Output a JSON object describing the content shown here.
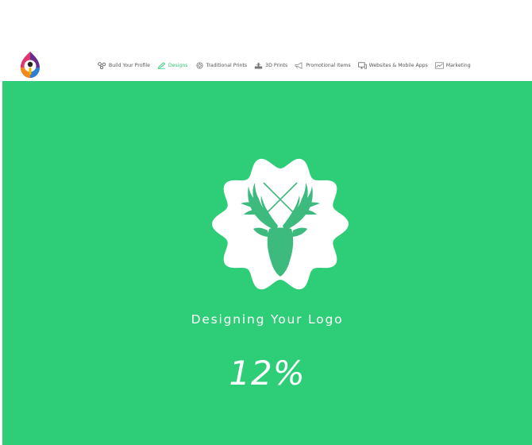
{
  "nav": {
    "items": [
      {
        "label": "Build Your Profile",
        "icon": "connection-icon",
        "active": false
      },
      {
        "label": "Designs",
        "icon": "pen-icon",
        "active": true
      },
      {
        "label": "Traditional Prints",
        "icon": "stamp-icon",
        "active": false
      },
      {
        "label": "3D Prints",
        "icon": "printer-3d-icon",
        "active": false
      },
      {
        "label": "Promotional Items",
        "icon": "megaphone-icon",
        "active": false
      },
      {
        "label": "Websites & Mobile Apps",
        "icon": "devices-icon",
        "active": false
      },
      {
        "label": "Marketing",
        "icon": "chart-icon",
        "active": false
      }
    ]
  },
  "hero": {
    "title": "Designing Your Logo",
    "progress": "12%"
  },
  "colors": {
    "accent": "#2ecd78",
    "accent_dark": "#3dba7e",
    "nav_text": "#555555",
    "nav_active": "#2ecc71"
  }
}
